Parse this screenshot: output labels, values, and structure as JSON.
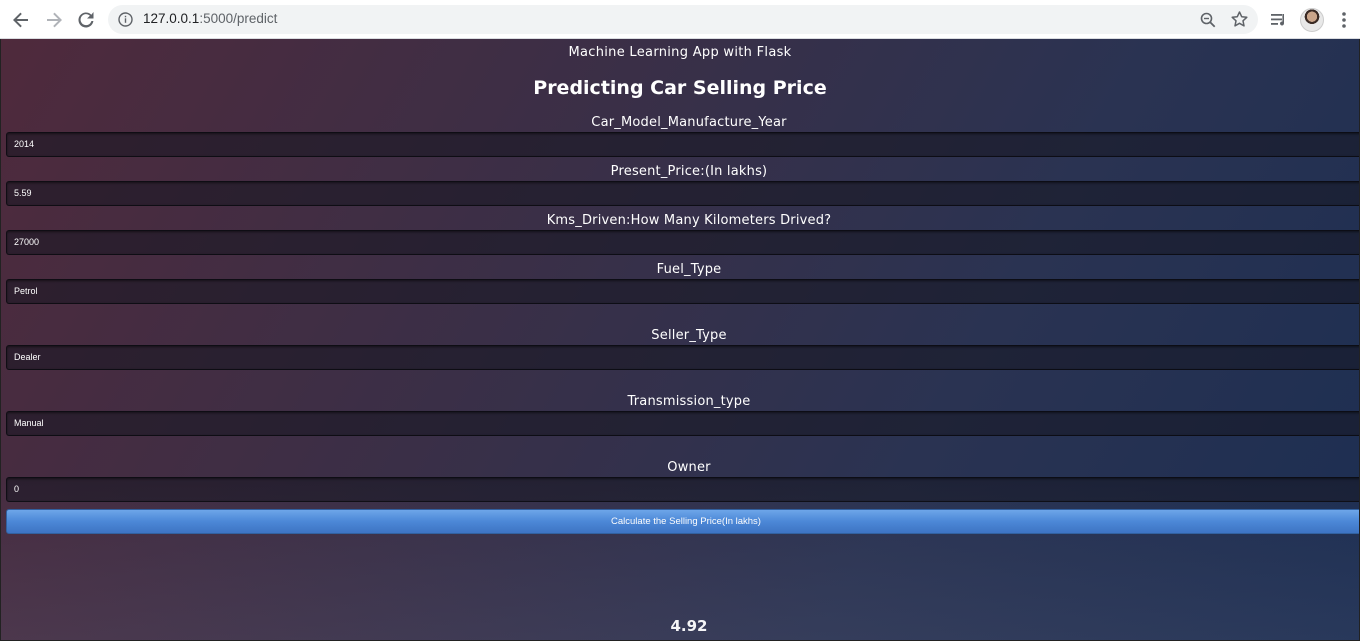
{
  "browser": {
    "url_host": "127.0.0.1",
    "url_path": ":5000/predict"
  },
  "page": {
    "app_title": "Machine Learning App with Flask",
    "heading": "Predicting Car Selling Price",
    "fields": [
      {
        "label": "Car_Model_Manufacture_Year",
        "value": "2014"
      },
      {
        "label": "Present_Price:(In lakhs)",
        "value": "5.59"
      },
      {
        "label": "Kms_Driven:How Many Kilometers Drived?",
        "value": "27000"
      },
      {
        "label": "Fuel_Type",
        "value": "Petrol"
      },
      {
        "label": "Seller_Type",
        "value": "Dealer"
      },
      {
        "label": "Transmission_type",
        "value": "Manual"
      },
      {
        "label": "Owner",
        "value": "0"
      }
    ],
    "submit_label": "Calculate the Selling Price(In lakhs)",
    "result": "4.92"
  },
  "colors": {
    "background_start": "#4f2a3c",
    "background_end": "#1c2e52",
    "button": "#4a87d8"
  }
}
